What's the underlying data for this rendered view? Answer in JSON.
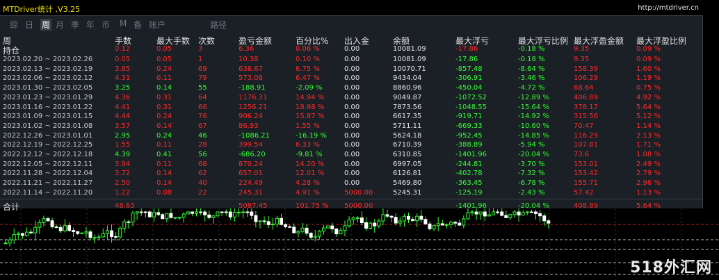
{
  "window": {
    "title": "MTDriver统计 ,V3.25",
    "site": "http://mtdriver.cn"
  },
  "menu": [
    {
      "label": "综",
      "active": false
    },
    {
      "label": "日",
      "active": false
    },
    {
      "label": "周",
      "active": true
    },
    {
      "label": "月",
      "active": false
    },
    {
      "label": "季",
      "active": false
    },
    {
      "label": "年",
      "active": false
    },
    {
      "label": "币",
      "active": false
    },
    {
      "label": "M",
      "active": false
    },
    {
      "label": "备",
      "active": false
    },
    {
      "label": "账户",
      "active": false
    },
    {
      "label": "路径",
      "active": false
    }
  ],
  "columns": [
    "周",
    "手数",
    "最大手数",
    "次数",
    "盈亏金额",
    "百分比%",
    "出入金",
    "余额",
    "最大浮亏",
    "最大浮亏比例",
    "最大浮盈金额",
    "最大浮盈比例"
  ],
  "holding": {
    "label": "持仓",
    "values": [
      "0.12",
      "0.05",
      "3",
      "6.36",
      "0.06 %",
      "0.00",
      "10081.09",
      "-17.86",
      "-0.18 %",
      "9.35",
      "0.09 %"
    ],
    "colors": [
      "red",
      "red",
      "red",
      "red",
      "red",
      "white",
      "white",
      "red",
      "green",
      "red",
      "red"
    ]
  },
  "rows": [
    {
      "period": "2023.02.20 ~ 2023.02.26",
      "profit": true,
      "values": [
        "0.05",
        "0.05",
        "1",
        "10.38",
        "0.10 %",
        "0.00",
        "10081.09",
        "-17.86",
        "-0.18 %",
        "9.35",
        "0.09 %"
      ]
    },
    {
      "period": "2023.02.13 ~ 2023.02.19",
      "profit": true,
      "values": [
        "3.85",
        "0.24",
        "69",
        "636.67",
        "6.75 %",
        "0.00",
        "10070.71",
        "-857.48",
        "-8.64 %",
        "158.39",
        "1.60 %"
      ]
    },
    {
      "period": "2023.02.06 ~ 2023.02.12",
      "profit": true,
      "values": [
        "4.31",
        "0.11",
        "79",
        "573.08",
        "6.47 %",
        "0.00",
        "9434.04",
        "-306.91",
        "-3.46 %",
        "106.29",
        "1.19 %"
      ]
    },
    {
      "period": "2023.01.30 ~ 2023.02.05",
      "profit": false,
      "values": [
        "3.25",
        "0.14",
        "55",
        "-188.91",
        "-2.09 %",
        "0.00",
        "8860.96",
        "-450.04",
        "-4.72 %",
        "68.64",
        "0.75 %"
      ]
    },
    {
      "period": "2023.01.23 ~ 2023.01.29",
      "profit": true,
      "values": [
        "4.36",
        "0.31",
        "64",
        "1176.31",
        "14.94 %",
        "0.00",
        "9049.87",
        "-1072.52",
        "-12.89 %",
        "406.89",
        "4.92 %"
      ]
    },
    {
      "period": "2023.01.16 ~ 2023.01.22",
      "profit": true,
      "values": [
        "4.41",
        "0.31",
        "66",
        "1256.21",
        "18.98 %",
        "0.00",
        "7873.56",
        "-1048.55",
        "-15.64 %",
        "378.17",
        "5.64 %"
      ]
    },
    {
      "period": "2023.01.09 ~ 2023.01.15",
      "profit": true,
      "values": [
        "4.44",
        "0.24",
        "76",
        "906.24",
        "15.87 %",
        "0.00",
        "6617.35",
        "-919.71",
        "-14.92 %",
        "315.56",
        "5.12 %"
      ]
    },
    {
      "period": "2023.01.02 ~ 2023.01.08",
      "profit": true,
      "values": [
        "3.57",
        "0.14",
        "67",
        "86.93",
        "1.55 %",
        "0.00",
        "5711.11",
        "-669.33",
        "-10.60 %",
        "70.47",
        "1.14 %"
      ]
    },
    {
      "period": "2022.12.26 ~ 2023.01.01",
      "profit": false,
      "values": [
        "2.95",
        "0.24",
        "46",
        "-1086.21",
        "-16.19 %",
        "0.00",
        "5624.18",
        "-952.45",
        "-14.85 %",
        "116.29",
        "2.13 %"
      ]
    },
    {
      "period": "2022.12.19 ~ 2022.12.25",
      "profit": true,
      "values": [
        "1.55",
        "0.11",
        "28",
        "399.54",
        "6.33 %",
        "0.00",
        "6710.39",
        "-388.89",
        "-5.94 %",
        "107.81",
        "1.71 %"
      ]
    },
    {
      "period": "2022.12.12 ~ 2022.12.18",
      "profit": false,
      "values": [
        "4.39",
        "0.41",
        "56",
        "-686.20",
        "-9.81 %",
        "0.00",
        "6310.85",
        "-1401.96",
        "-20.04 %",
        "73.6",
        "1.08 %"
      ]
    },
    {
      "period": "2022.12.05 ~ 2022.12.11",
      "profit": true,
      "values": [
        "3.94",
        "0.11",
        "68",
        "870.24",
        "14.20 %",
        "0.00",
        "6997.05",
        "-244.81",
        "-3.70 %",
        "153.01",
        "2.49 %"
      ]
    },
    {
      "period": "2022.11.28 ~ 2022.12.04",
      "profit": true,
      "values": [
        "3.72",
        "0.14",
        "62",
        "657.01",
        "12.01 %",
        "0.00",
        "6126.81",
        "-402.78",
        "-7.32 %",
        "153.42",
        "2.79 %"
      ]
    },
    {
      "period": "2022.11.21 ~ 2022.11.27",
      "profit": true,
      "values": [
        "2.50",
        "0.14",
        "40",
        "224.49",
        "4.28 %",
        "0.00",
        "5469.80",
        "-363.45",
        "-6.78 %",
        "155.71",
        "2.96 %"
      ]
    },
    {
      "period": "2022.11.14 ~ 2022.11.20",
      "profit": true,
      "values": [
        "1.22",
        "0.08",
        "22",
        "245.31",
        "4.91 %",
        "5000.00",
        "5245.31",
        "-125.19",
        "-2.43 %",
        "57.42",
        "1.13 %"
      ]
    }
  ],
  "total": {
    "label": "合计",
    "values": [
      "48.63",
      "",
      "",
      "5087.45",
      "101.75 %",
      "5000.00",
      "",
      "-1401.96",
      "-20.04 %",
      "408.89",
      "5.64 %"
    ],
    "colors": [
      "red",
      "white",
      "white",
      "red",
      "red",
      "red",
      "white",
      "green",
      "green",
      "red",
      "red"
    ]
  },
  "watermark": "518外汇网",
  "colors": {
    "profit": "#ff2b2b",
    "loss": "#33ff33",
    "panel": "#1b1f26",
    "title": "#f4e200"
  }
}
